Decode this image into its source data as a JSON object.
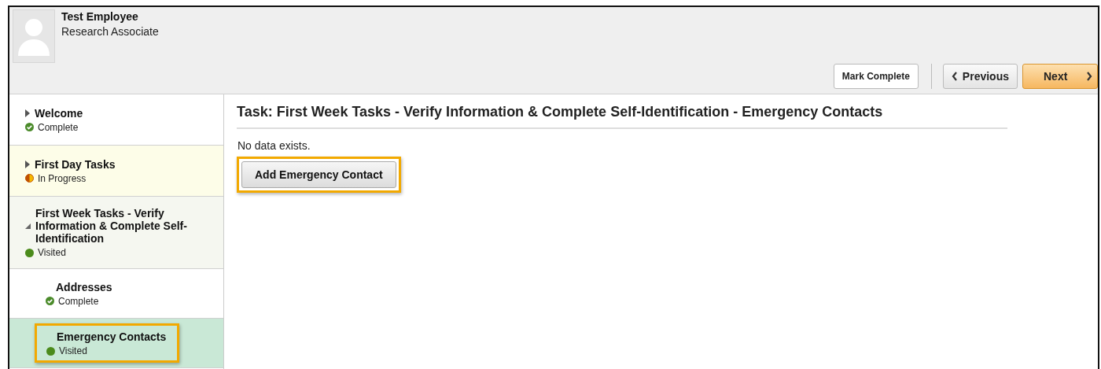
{
  "employee": {
    "name": "Test Employee",
    "title": "Research Associate"
  },
  "actions": [
    {
      "label": "Mark Complete",
      "kind": "plain"
    },
    {
      "label": "Previous",
      "kind": "back"
    },
    {
      "label": "Next",
      "kind": "forward"
    }
  ],
  "steps": [
    {
      "label": "Welcome",
      "status": "Complete",
      "kind": "complete",
      "expanded": false,
      "selected": false,
      "highlighted": false
    },
    {
      "label": "First Day Tasks",
      "status": "In Progress",
      "kind": "in_progress",
      "expanded": false,
      "selected": false,
      "highlighted": false
    },
    {
      "label": "First Week Tasks - Verify Information & Complete Self-Identification",
      "status": "Visited",
      "kind": "visited",
      "expanded": true,
      "selected": false,
      "highlighted": false,
      "children": [
        {
          "label": "Addresses",
          "status": "Complete",
          "kind": "complete",
          "selected": false,
          "highlighted": false
        },
        {
          "label": "Emergency Contacts",
          "status": "Visited",
          "kind": "visited",
          "selected": true,
          "highlighted": true
        }
      ]
    }
  ],
  "task": {
    "title": "Task: First Week Tasks - Verify Information & Complete Self-Identification - Emergency Contacts",
    "message": "No data exists.",
    "button": {
      "label": "Add Emergency Contact",
      "highlighted": true
    }
  }
}
